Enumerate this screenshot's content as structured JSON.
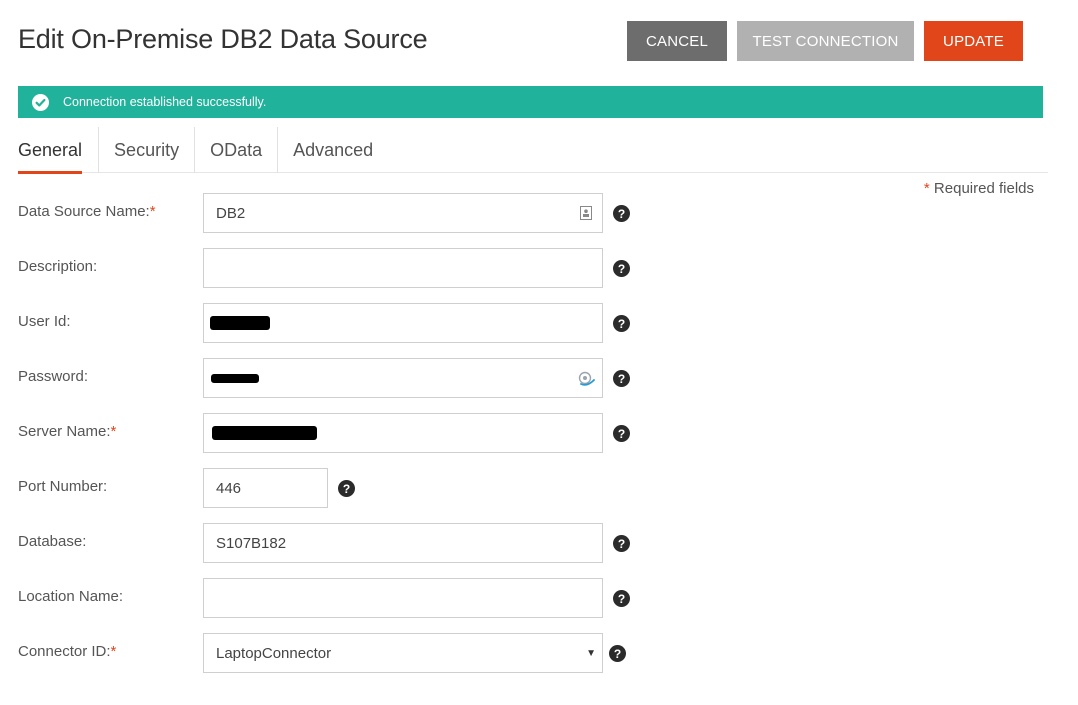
{
  "header": {
    "title": "Edit On-Premise DB2 Data Source",
    "cancel_label": "CANCEL",
    "test_label": "TEST CONNECTION",
    "update_label": "UPDATE"
  },
  "alert": {
    "message": "Connection established successfully."
  },
  "tabs": [
    {
      "label": "General",
      "active": true
    },
    {
      "label": "Security"
    },
    {
      "label": "OData"
    },
    {
      "label": "Advanced"
    }
  ],
  "required_note": {
    "star": "*",
    "text": " Required fields"
  },
  "form": {
    "data_source_name": {
      "label": "Data Source Name:",
      "required": "*",
      "value": "DB2"
    },
    "description": {
      "label": "Description:",
      "value": ""
    },
    "user_id": {
      "label": "User Id:"
    },
    "password": {
      "label": "Password:"
    },
    "server_name": {
      "label": "Server Name:",
      "required": "*"
    },
    "port_number": {
      "label": "Port Number:",
      "value": "446"
    },
    "database": {
      "label": "Database:",
      "value": "S107B182"
    },
    "location_name": {
      "label": "Location Name:",
      "value": ""
    },
    "connector_id": {
      "label": "Connector ID:",
      "required": "*",
      "value": "LaptopConnector"
    }
  },
  "help_glyph": "?",
  "colors": {
    "accent": "#e0461a",
    "success": "#20b29a",
    "cancel": "#6d6d6d",
    "test": "#b1b1b1"
  }
}
